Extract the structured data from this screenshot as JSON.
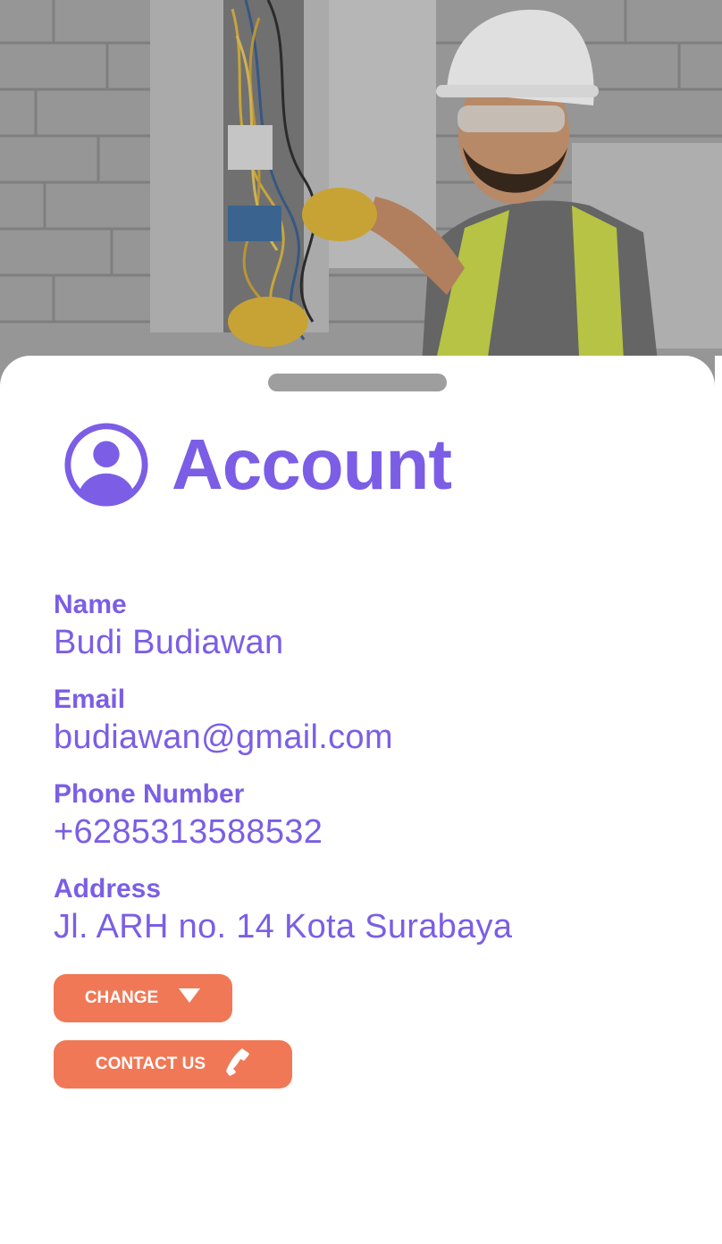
{
  "hero": {
    "image_subject": "Electrician in white hard hat and safety vest working on an electrical panel"
  },
  "header": {
    "icon": "account-circle-icon",
    "title": "Account"
  },
  "profile": {
    "fields": [
      {
        "label": "Name",
        "value": "Budi Budiawan"
      },
      {
        "label": "Email",
        "value": "budiawan@gmail.com"
      },
      {
        "label": "Phone Number",
        "value": "+6285313588532"
      },
      {
        "label": "Address",
        "value": "Jl. ARH no. 14 Kota Surabaya"
      }
    ]
  },
  "buttons": {
    "change": {
      "label": "CHANGE",
      "icon": "triangle-down-icon"
    },
    "contact": {
      "label": "CONTACT US",
      "icon": "phone-icon"
    }
  },
  "colors": {
    "accent": "#7b5ee5",
    "button": "#f07856",
    "button_text": "#ffffff",
    "handle": "#9e9e9e"
  }
}
